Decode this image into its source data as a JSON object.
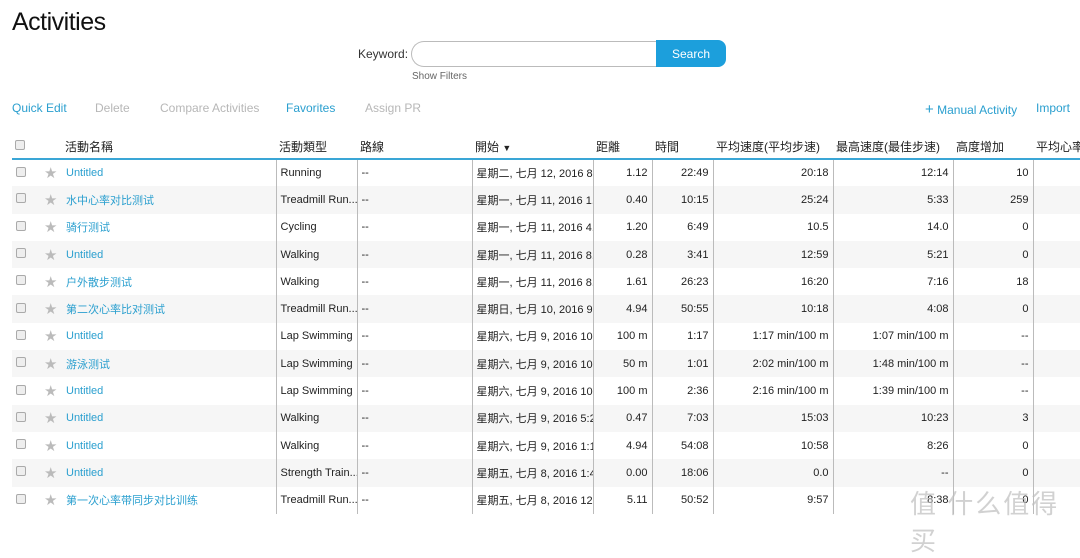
{
  "header": {
    "title": "Activities"
  },
  "search": {
    "label": "Keyword:",
    "value": "",
    "placeholder": "",
    "button": "Search",
    "show_filters": "Show Filters"
  },
  "toolbar": {
    "quick_edit": "Quick Edit",
    "delete": "Delete",
    "compare": "Compare Activities",
    "favorites": "Favorites",
    "assign_pr": "Assign PR",
    "manual": "Manual Activity",
    "import": "Import"
  },
  "columns": [
    "活動名稱",
    "活動類型",
    "路線",
    "開始",
    "距離",
    "時間",
    "平均速度(平均步速)",
    "最高速度(最佳步速)",
    "高度增加",
    "平均心率"
  ],
  "rows": [
    [
      "Untitled",
      "Running",
      "--",
      "星期二, 七月 12, 2016 8...",
      "1.12",
      "22:49",
      "20:18",
      "12:14",
      "10"
    ],
    [
      "水中心率对比测试",
      "Treadmill Run...",
      "--",
      "星期一, 七月 11, 2016 1...",
      "0.40",
      "10:15",
      "25:24",
      "5:33",
      "259"
    ],
    [
      "骑行测试",
      "Cycling",
      "--",
      "星期一, 七月 11, 2016 4...",
      "1.20",
      "6:49",
      "10.5",
      "14.0",
      "0"
    ],
    [
      "Untitled",
      "Walking",
      "--",
      "星期一, 七月 11, 2016 8...",
      "0.28",
      "3:41",
      "12:59",
      "5:21",
      "0"
    ],
    [
      "户外散步测试",
      "Walking",
      "--",
      "星期一, 七月 11, 2016 8...",
      "1.61",
      "26:23",
      "16:20",
      "7:16",
      "18"
    ],
    [
      "第二次心率比对测试",
      "Treadmill Run...",
      "--",
      "星期日, 七月 10, 2016 9...",
      "4.94",
      "50:55",
      "10:18",
      "4:08",
      "0"
    ],
    [
      "Untitled",
      "Lap Swimming",
      "--",
      "星期六, 七月 9, 2016 10...",
      "100 m",
      "1:17",
      "1:17 min/100 m",
      "1:07 min/100 m",
      "--"
    ],
    [
      "游泳测试",
      "Lap Swimming",
      "--",
      "星期六, 七月 9, 2016 10...",
      "50 m",
      "1:01",
      "2:02 min/100 m",
      "1:48 min/100 m",
      "--"
    ],
    [
      "Untitled",
      "Lap Swimming",
      "--",
      "星期六, 七月 9, 2016 10...",
      "100 m",
      "2:36",
      "2:16 min/100 m",
      "1:39 min/100 m",
      "--"
    ],
    [
      "Untitled",
      "Walking",
      "--",
      "星期六, 七月 9, 2016 5:2...",
      "0.47",
      "7:03",
      "15:03",
      "10:23",
      "3"
    ],
    [
      "Untitled",
      "Walking",
      "--",
      "星期六, 七月 9, 2016 1:1...",
      "4.94",
      "54:08",
      "10:58",
      "8:26",
      "0"
    ],
    [
      "Untitled",
      "Strength Train...",
      "--",
      "星期五, 七月 8, 2016 1:4...",
      "0.00",
      "18:06",
      "0.0",
      "--",
      "0"
    ],
    [
      "第一次心率带同步对比训练",
      "Treadmill Run...",
      "--",
      "星期五, 七月 8, 2016 12...",
      "5.11",
      "50:52",
      "9:57",
      "8:38",
      "0"
    ]
  ],
  "watermark": "值 什么值得买",
  "colors": {
    "accent": "#1c9fdc",
    "link": "#2a9fcf",
    "disabled": "#b7b7b7"
  }
}
